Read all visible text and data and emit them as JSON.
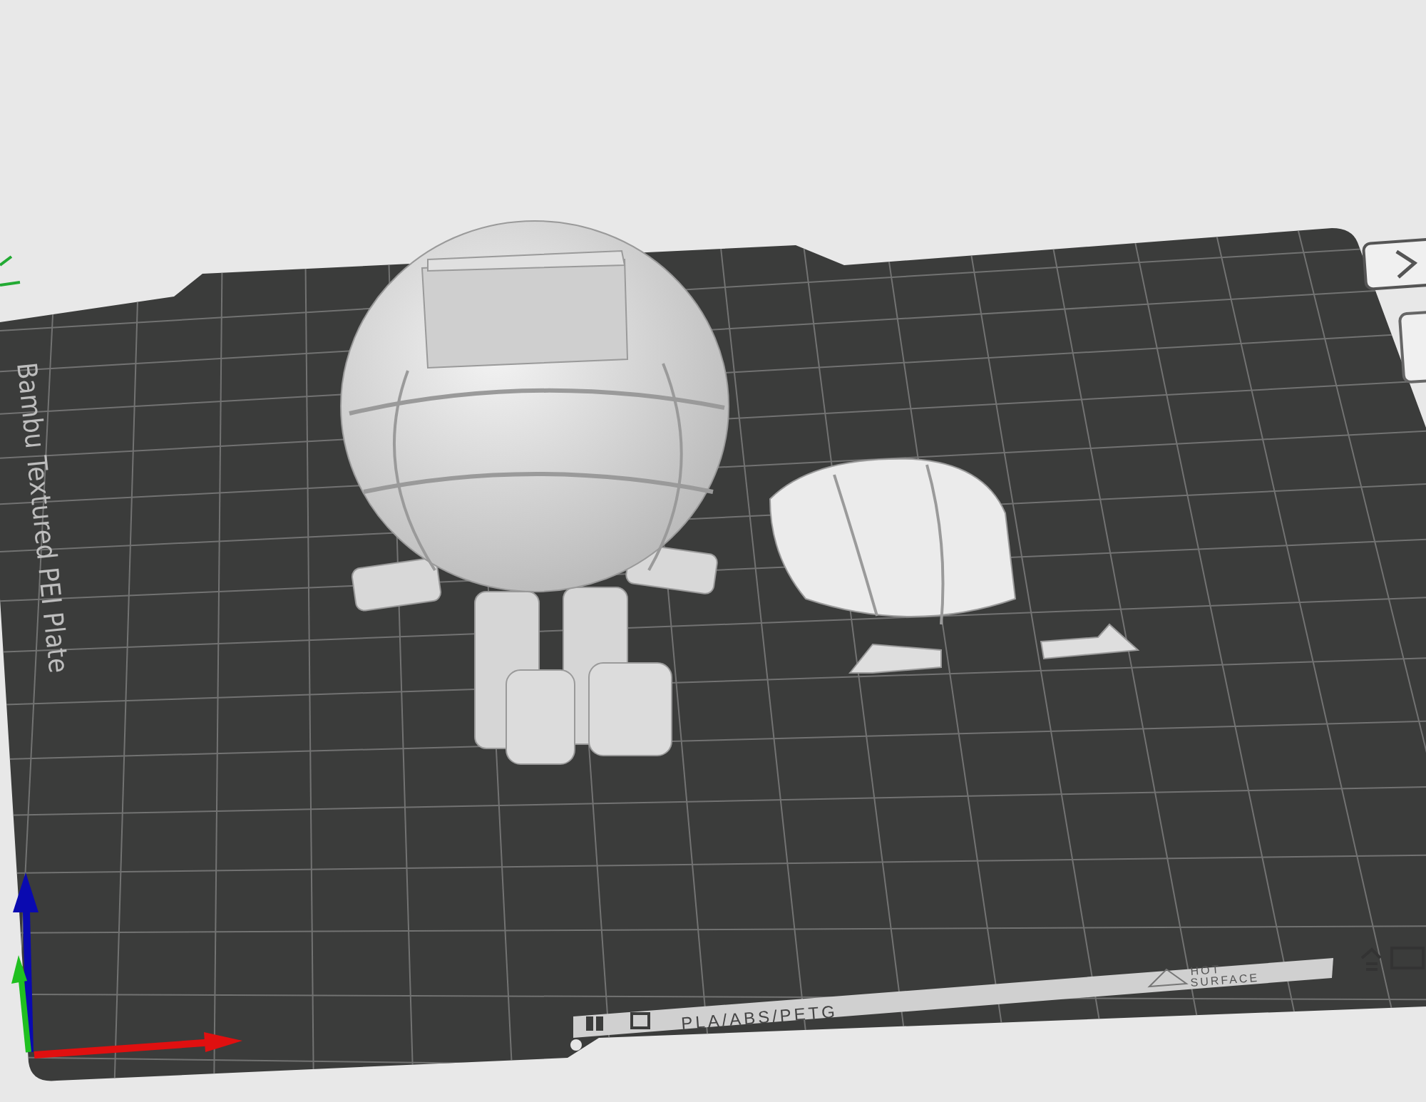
{
  "plate": {
    "name": "Bambu Textured PEI Plate",
    "label_strip": {
      "materials": "PLA/ABS/PETG",
      "warning_lines": [
        "HOT",
        "SURFACE"
      ]
    }
  }
}
